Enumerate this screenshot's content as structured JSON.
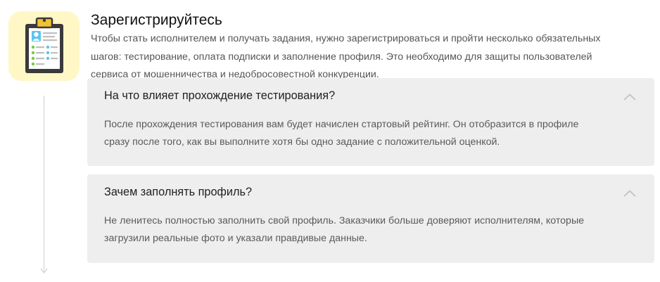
{
  "step": {
    "title": "Зарегистрируйтесь",
    "description_lines": [
      "Чтобы стать исполнителем и получать задания, нужно зарегистрироваться и пройти несколько обязательных",
      "шагов: тестирование, оплата подписки и заполнение профиля. Это необходимо для защиты пользователей",
      "сервиса от мошенничества и недобросовестной конкуренции."
    ],
    "icon": "clipboard-icon"
  },
  "faq": [
    {
      "question": "На что влияет прохождение тестирования?",
      "answer_lines": [
        "После прохождения тестирования вам будет начислен стартовый рейтинг. Он отобразится в профиле",
        "сразу после того, как вы выполните хотя бы одно задание с положительной оценкой."
      ],
      "expanded": true
    },
    {
      "question": "Зачем заполнять профиль?",
      "answer_lines": [
        "Не ленитесь полностью заполнить свой профиль. Заказчики больше доверяют исполнителям, которые",
        "загрузили реальные фото и указали правдивые данные."
      ],
      "expanded": true
    }
  ],
  "colors": {
    "icon_background": "#fff7c6",
    "panel_background": "#eeeeee",
    "timeline": "#cfcfcf"
  }
}
